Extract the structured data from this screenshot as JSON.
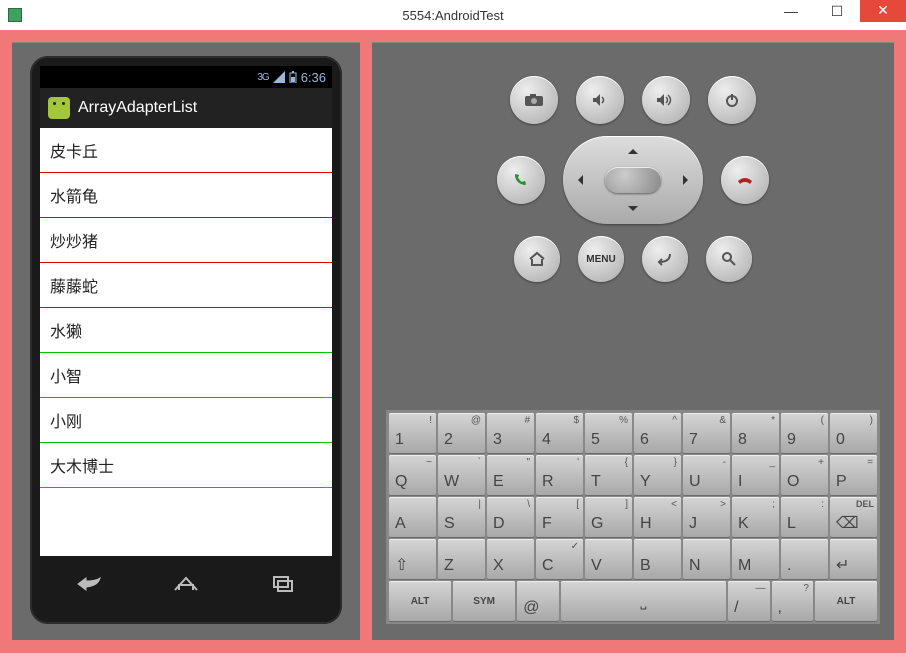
{
  "window": {
    "title": "5554:AndroidTest"
  },
  "statusbar": {
    "network_label": "3G",
    "time": "6:36"
  },
  "app": {
    "title": "ArrayAdapterList"
  },
  "list": {
    "items": [
      {
        "label": "皮卡丘",
        "divider": "red"
      },
      {
        "label": "水箭龟",
        "divider": "red"
      },
      {
        "label": "炒炒猪",
        "divider": "red"
      },
      {
        "label": "藤藤蛇",
        "divider": "red"
      },
      {
        "label": "水獭",
        "divider": "green"
      },
      {
        "label": "小智",
        "divider": "green"
      },
      {
        "label": "小刚",
        "divider": "green"
      },
      {
        "label": "大木博士",
        "divider": "green"
      }
    ]
  },
  "hw_buttons": {
    "menu_label": "MENU"
  },
  "keyboard": {
    "rows": [
      [
        {
          "main": "1",
          "sup": "!"
        },
        {
          "main": "2",
          "sup": "@"
        },
        {
          "main": "3",
          "sup": "#"
        },
        {
          "main": "4",
          "sup": "$"
        },
        {
          "main": "5",
          "sup": "%"
        },
        {
          "main": "6",
          "sup": "^"
        },
        {
          "main": "7",
          "sup": "&"
        },
        {
          "main": "8",
          "sup": "*"
        },
        {
          "main": "9",
          "sup": "("
        },
        {
          "main": "0",
          "sup": ")"
        }
      ],
      [
        {
          "main": "Q",
          "sup": "~"
        },
        {
          "main": "W",
          "sup": "`"
        },
        {
          "main": "E",
          "sup": "\""
        },
        {
          "main": "R",
          "sup": "'"
        },
        {
          "main": "T",
          "sup": "{"
        },
        {
          "main": "Y",
          "sup": "}"
        },
        {
          "main": "U",
          "sup": "-"
        },
        {
          "main": "I",
          "sup": "_"
        },
        {
          "main": "O",
          "sup": "+"
        },
        {
          "main": "P",
          "sup": "="
        }
      ],
      [
        {
          "main": "A",
          "sup": ""
        },
        {
          "main": "S",
          "sup": "|"
        },
        {
          "main": "D",
          "sup": "\\"
        },
        {
          "main": "F",
          "sup": "["
        },
        {
          "main": "G",
          "sup": "]"
        },
        {
          "main": "H",
          "sup": "<"
        },
        {
          "main": "J",
          "sup": ">"
        },
        {
          "main": "K",
          "sup": ";"
        },
        {
          "main": "L",
          "sup": ":"
        },
        {
          "main": "⌫",
          "sup": "DEL",
          "cls": "del"
        }
      ],
      [
        {
          "main": "⇧",
          "sup": ""
        },
        {
          "main": "Z",
          "sup": ""
        },
        {
          "main": "X",
          "sup": ""
        },
        {
          "main": "C",
          "sup": "✓"
        },
        {
          "main": "V",
          "sup": ""
        },
        {
          "main": "B",
          "sup": ""
        },
        {
          "main": "N",
          "sup": ""
        },
        {
          "main": "M",
          "sup": ""
        },
        {
          "main": ".",
          "sup": ""
        },
        {
          "main": "↵",
          "sup": ""
        }
      ],
      [
        {
          "label": "ALT",
          "cls": "wide sm-txt"
        },
        {
          "label": "SYM",
          "cls": "wide sm-txt"
        },
        {
          "main": "@",
          "sup": ""
        },
        {
          "label": "⎵",
          "cls": "space"
        },
        {
          "main": "/",
          "sup": "—"
        },
        {
          "main": ",",
          "sup": "?"
        },
        {
          "label": "ALT",
          "cls": "wide sm-txt"
        }
      ]
    ]
  }
}
